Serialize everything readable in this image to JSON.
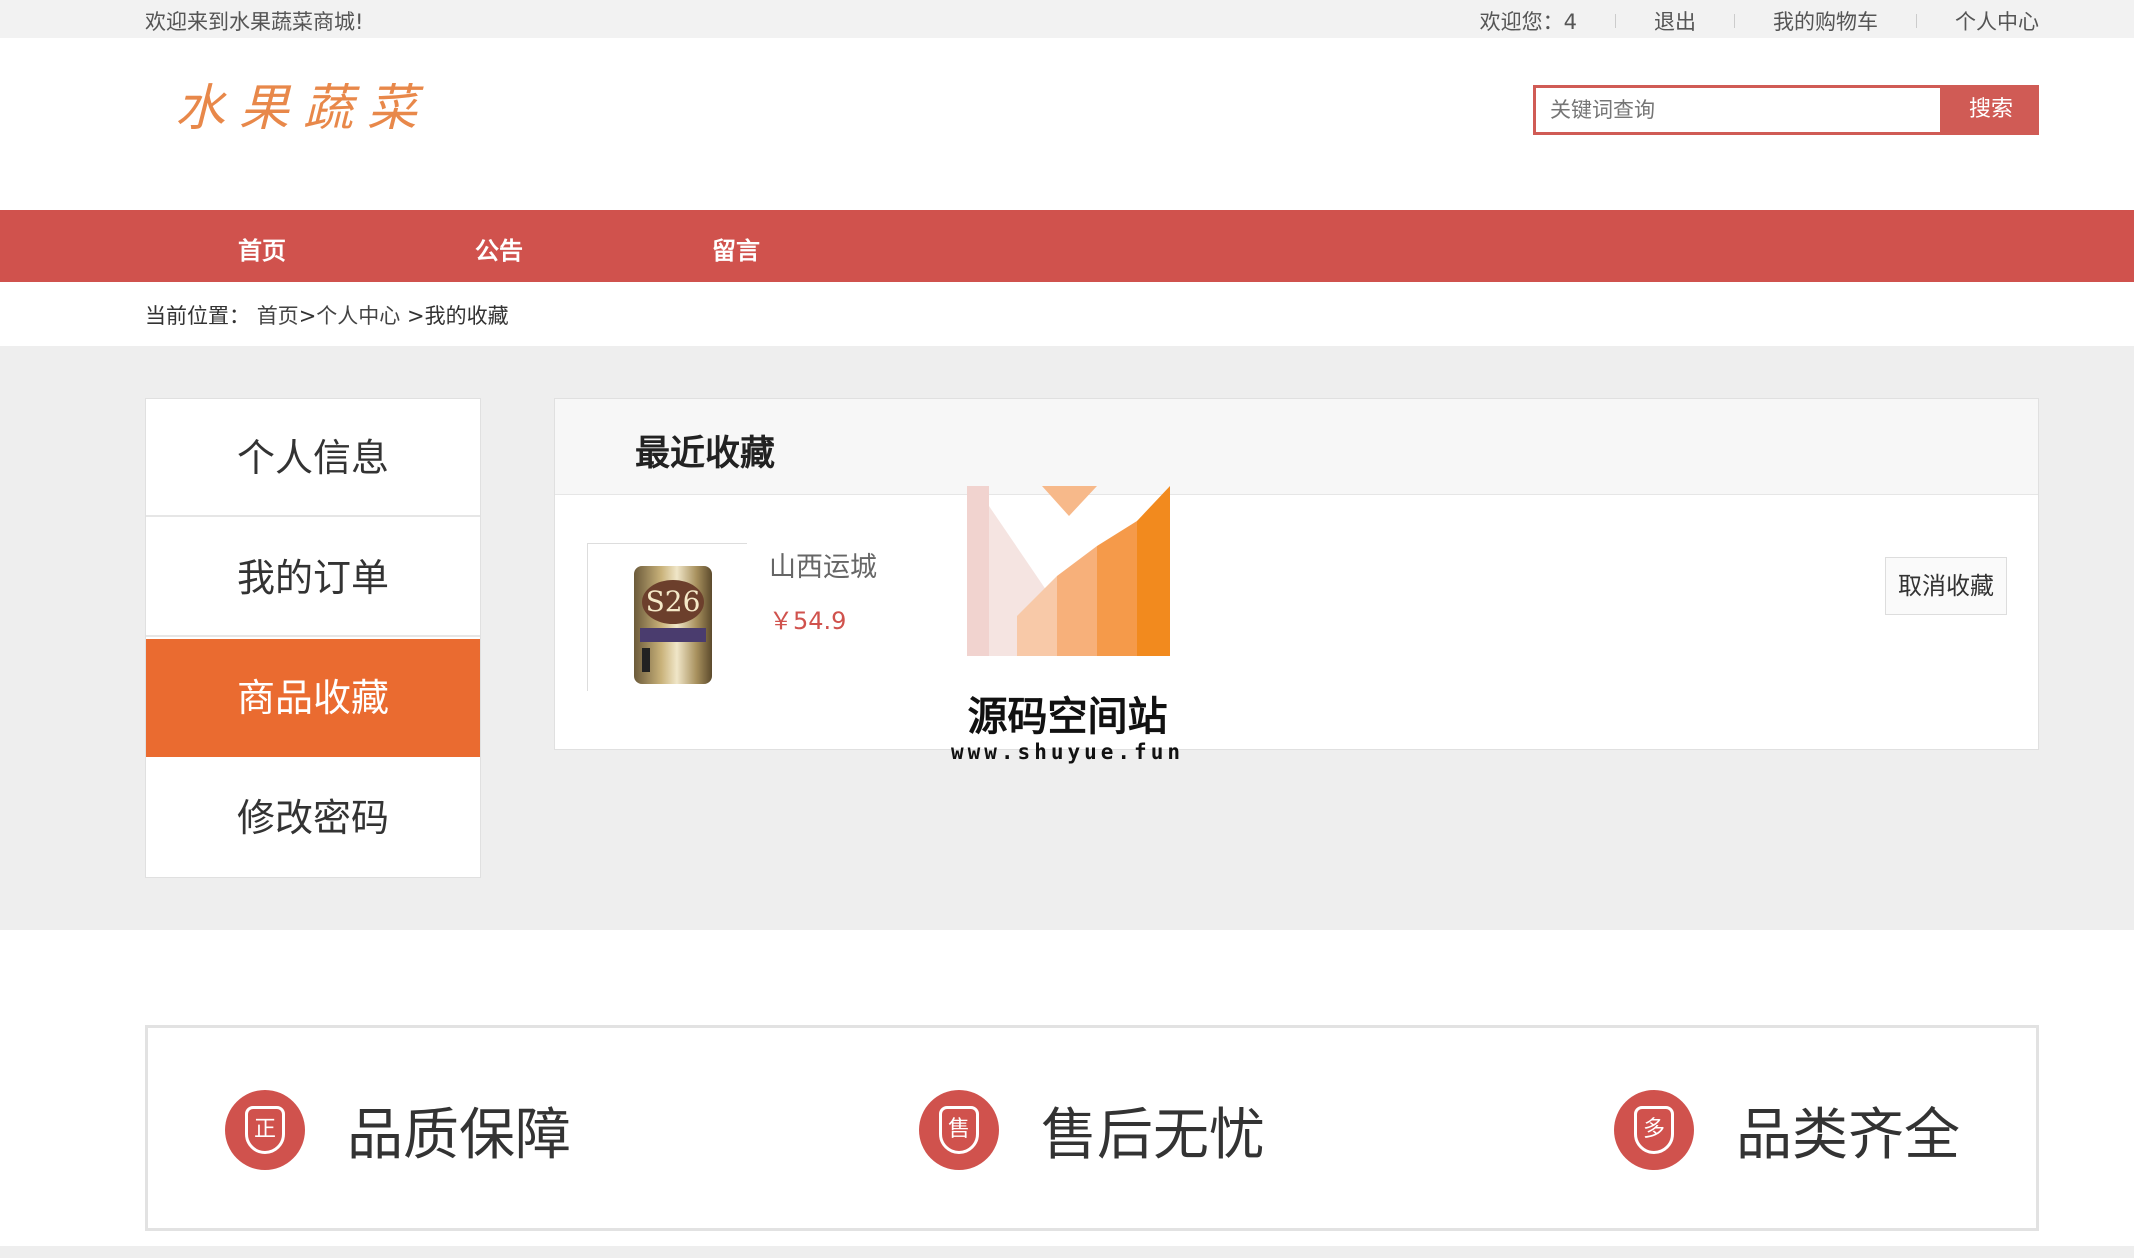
{
  "topbar": {
    "welcome": "欢迎来到水果蔬菜商城!",
    "greeting": "欢迎您：4",
    "logout": "退出",
    "cart": "我的购物车",
    "user_center": "个人中心"
  },
  "header": {
    "logo": "水果蔬菜",
    "search_placeholder": "关键词查询",
    "search_button": "搜索"
  },
  "nav": {
    "items": [
      "首页",
      "公告",
      "留言"
    ]
  },
  "breadcrumb": {
    "prefix": "当前位置：",
    "home": "首页",
    "sep1": ">",
    "center": "个人中心",
    "sep2": " >",
    "current": "我的收藏"
  },
  "sidebar": {
    "items": [
      {
        "label": "个人信息",
        "active": false
      },
      {
        "label": "我的订单",
        "active": false
      },
      {
        "label": "商品收藏",
        "active": true
      },
      {
        "label": "修改密码",
        "active": false
      }
    ]
  },
  "favorites": {
    "title": "最近收藏",
    "items": [
      {
        "name": "山西运城",
        "price": "￥54.9",
        "image_text": "S26",
        "cancel_label": "取消收藏"
      }
    ]
  },
  "watermark": {
    "title": "源码空间站",
    "url": "www.shuyue.fun"
  },
  "features": [
    {
      "icon_text": "正",
      "label": "品质保障",
      "icon": "quality-shield-icon"
    },
    {
      "icon_text": "售",
      "label": "售后无忧",
      "icon": "aftersale-shield-icon"
    },
    {
      "icon_text": "多",
      "label": "品类齐全",
      "icon": "variety-shield-icon"
    }
  ],
  "colors": {
    "brand_red": "#d0524d",
    "active_orange": "#ea6b30",
    "logo_orange": "#e8884a"
  }
}
